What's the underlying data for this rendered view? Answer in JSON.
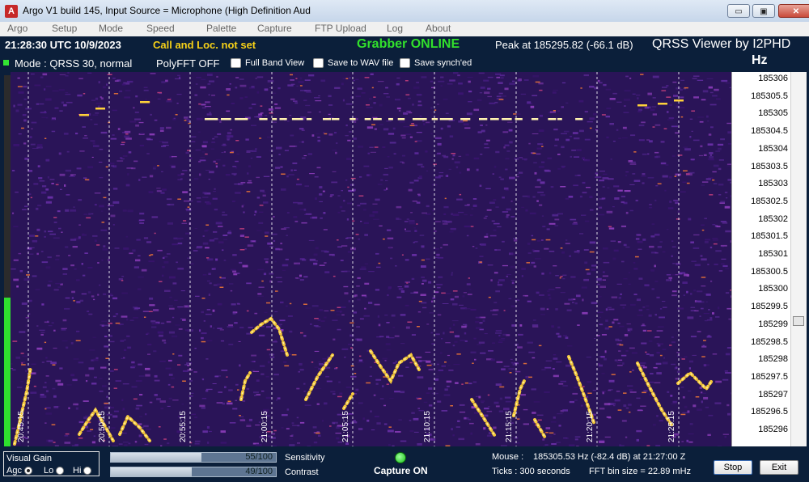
{
  "window": {
    "title": "Argo V1 build 145, Input Source = Microphone (High Definition Aud",
    "app_icon_glyph": "A",
    "minimize_glyph": "▭",
    "maximize_glyph": "▣",
    "close_glyph": "✕"
  },
  "menu": [
    "Argo",
    "Setup",
    "Mode",
    "Speed",
    "Palette",
    "Capture",
    "FTP Upload",
    "Log",
    "About"
  ],
  "header": {
    "time": "21:28:30 UTC  10/9/2023",
    "call": "Call and Loc. not set",
    "grabber": "Grabber ONLINE",
    "peak": "Peak at  185295.82 (-66.1 dB)",
    "viewer": "QRSS Viewer by I2PHD",
    "hz": "Hz",
    "mode": "Mode : QRSS 30, normal",
    "polyfft": "PolyFFT OFF",
    "checkboxes": [
      {
        "label": "Full Band View",
        "checked": false
      },
      {
        "label": "Save to WAV file",
        "checked": false
      },
      {
        "label": "Save synch'ed",
        "checked": false
      }
    ]
  },
  "waterfall": {
    "freq_labels": [
      "185306",
      "185305.5",
      "185305",
      "185304.5",
      "185304",
      "185303.5",
      "185303",
      "185302.5",
      "185302",
      "185301.5",
      "185301",
      "185300.5",
      "185300",
      "185299.5",
      "185299",
      "185298.5",
      "185298",
      "185297.5",
      "185297",
      "185296.5",
      "185296"
    ],
    "time_labels": [
      "20:45:15",
      "20:50:15",
      "20:55:15",
      "21:00:15",
      "21:05:15",
      "21:10:15",
      "21:15:15",
      "21:20:15",
      "21:25:15"
    ],
    "colors": {
      "background": "#2a1458",
      "speckle": "#5e2a9e",
      "signal": "#ffd23a",
      "signal_core": "#fff3b0",
      "marker_line": "#ffffff"
    },
    "left_level_fraction": 0.4
  },
  "footer": {
    "visual_gain": "Visual Gain",
    "agc": "Agc",
    "lo": "Lo",
    "hi": "Hi",
    "agc_selected": true,
    "sensitivity_value": "55/100",
    "sensitivity_fraction": 0.55,
    "sensitivity_label": "Sensitivity",
    "contrast_value": "49/100",
    "contrast_fraction": 0.49,
    "contrast_label": "Contrast",
    "capture_led_glyph": "●",
    "capture": "Capture ON",
    "mouse_label": "Mouse :",
    "mouse_value": "185305.53 Hz  (-82.4 dB) at 21:27:00 Z",
    "ticks": "Ticks  : 300 seconds",
    "fft_bin": "FFT bin size = 22.89 mHz",
    "stop": "Stop",
    "exit": "Exit"
  }
}
